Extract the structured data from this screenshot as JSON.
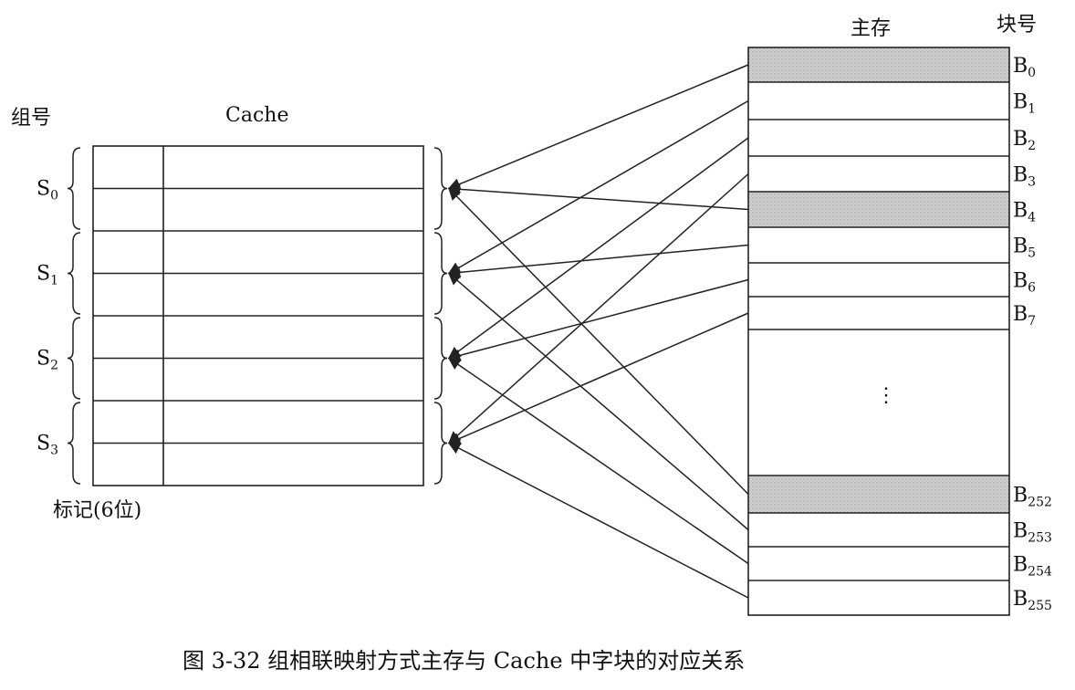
{
  "labels": {
    "group_header": "组号",
    "cache_header": "Cache",
    "main_header": "主存",
    "block_header": "块号",
    "tag_label": "标记(6位)",
    "ellipsis": "⋮",
    "caption": "图 3-32    组相联映射方式主存与 Cache 中字块的对应关系"
  },
  "cache": {
    "sets": [
      {
        "base": "S",
        "sub": "0"
      },
      {
        "base": "S",
        "sub": "1"
      },
      {
        "base": "S",
        "sub": "2"
      },
      {
        "base": "S",
        "sub": "3"
      }
    ]
  },
  "memory": {
    "blocks": [
      {
        "base": "B",
        "sub": "0",
        "shaded": true
      },
      {
        "base": "B",
        "sub": "1",
        "shaded": false
      },
      {
        "base": "B",
        "sub": "2",
        "shaded": false
      },
      {
        "base": "B",
        "sub": "3",
        "shaded": false
      },
      {
        "base": "B",
        "sub": "4",
        "shaded": true
      },
      {
        "base": "B",
        "sub": "5",
        "shaded": false
      },
      {
        "base": "B",
        "sub": "6",
        "shaded": false
      },
      {
        "base": "B",
        "sub": "7",
        "shaded": false
      },
      {
        "base": "B",
        "sub": "252",
        "shaded": true
      },
      {
        "base": "B",
        "sub": "253",
        "shaded": false
      },
      {
        "base": "B",
        "sub": "254",
        "shaded": false
      },
      {
        "base": "B",
        "sub": "255",
        "shaded": false
      }
    ]
  },
  "colors": {
    "shade": "#c8c8c8",
    "line": "#222222"
  }
}
